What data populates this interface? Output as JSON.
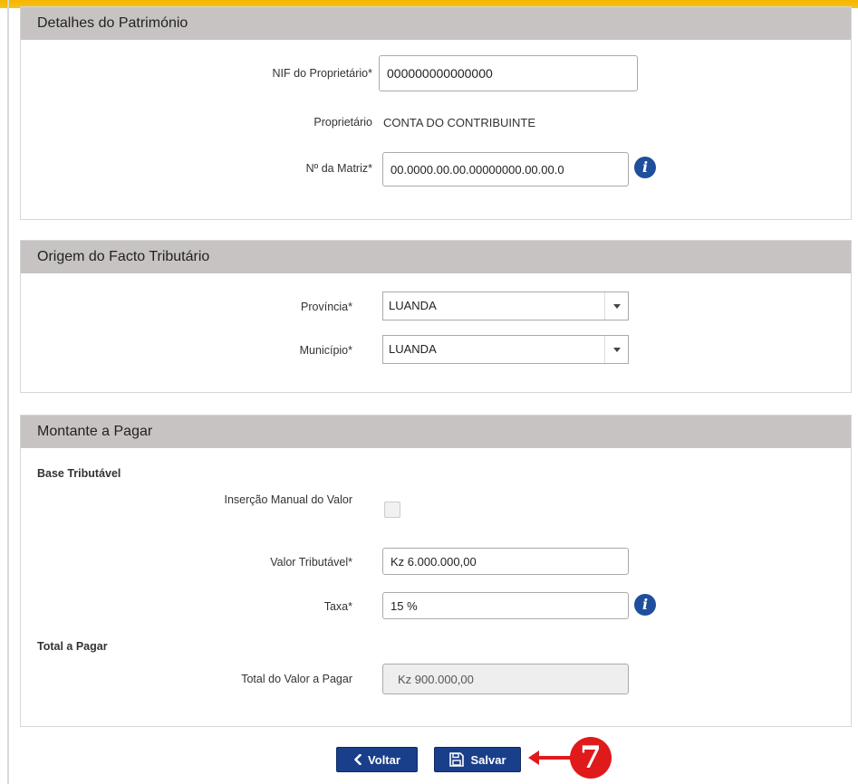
{
  "patrimonio": {
    "header": "Detalhes do Património",
    "nif_label": "NIF do Proprietário*",
    "nif_value": "000000000000000",
    "proprietario_label": "Proprietário",
    "proprietario_value": "CONTA DO CONTRIBUINTE",
    "matriz_label": "Nº da Matriz*",
    "matriz_value": "00.0000.00.00.00000000.00.00.0",
    "info_glyph": "i"
  },
  "origem": {
    "header": "Origem do Facto Tributário",
    "provincia_label": "Província*",
    "provincia_value": "LUANDA",
    "municipio_label": "Município*",
    "municipio_value": "LUANDA"
  },
  "montante": {
    "header": "Montante a Pagar",
    "base_title": "Base Tributável",
    "manual_label": "Inserção Manual do Valor",
    "valor_label": "Valor Tributável*",
    "valor_value": "Kz 6.000.000,00",
    "taxa_label": "Taxa*",
    "taxa_value": "15 %",
    "total_title": "Total a Pagar",
    "total_label": "Total do Valor a Pagar",
    "total_value": "Kz 900.000,00",
    "info_glyph": "i"
  },
  "actions": {
    "voltar_label": "Voltar",
    "salvar_label": "Salvar",
    "step_marker": "7"
  },
  "colors": {
    "accent": "#1a3f8a",
    "header_bg": "#c8c3c3",
    "marker": "#e0191b",
    "top_bar": "#f7b500"
  },
  "icons": {
    "voltar": "chevron-left-icon",
    "salvar": "floppy-disk-icon",
    "info": "info-icon",
    "select": "caret-down-icon"
  }
}
